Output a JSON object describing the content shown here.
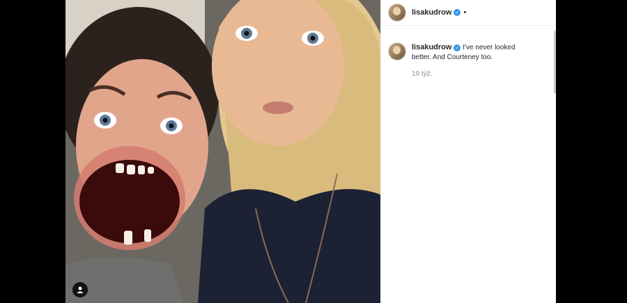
{
  "post": {
    "username": "lisakudrow",
    "verified": true,
    "follow_separator": "•",
    "caption_username": "lisakudrow",
    "caption_text": "I've never looked better. And Courteney too.",
    "timestamp": "19 týž.",
    "icons": {
      "verified": "verified-badge-icon",
      "tag": "user-tag-icon"
    },
    "colors": {
      "verified_blue": "#3897f0",
      "text": "#262626",
      "muted": "#8e8e8e"
    }
  }
}
